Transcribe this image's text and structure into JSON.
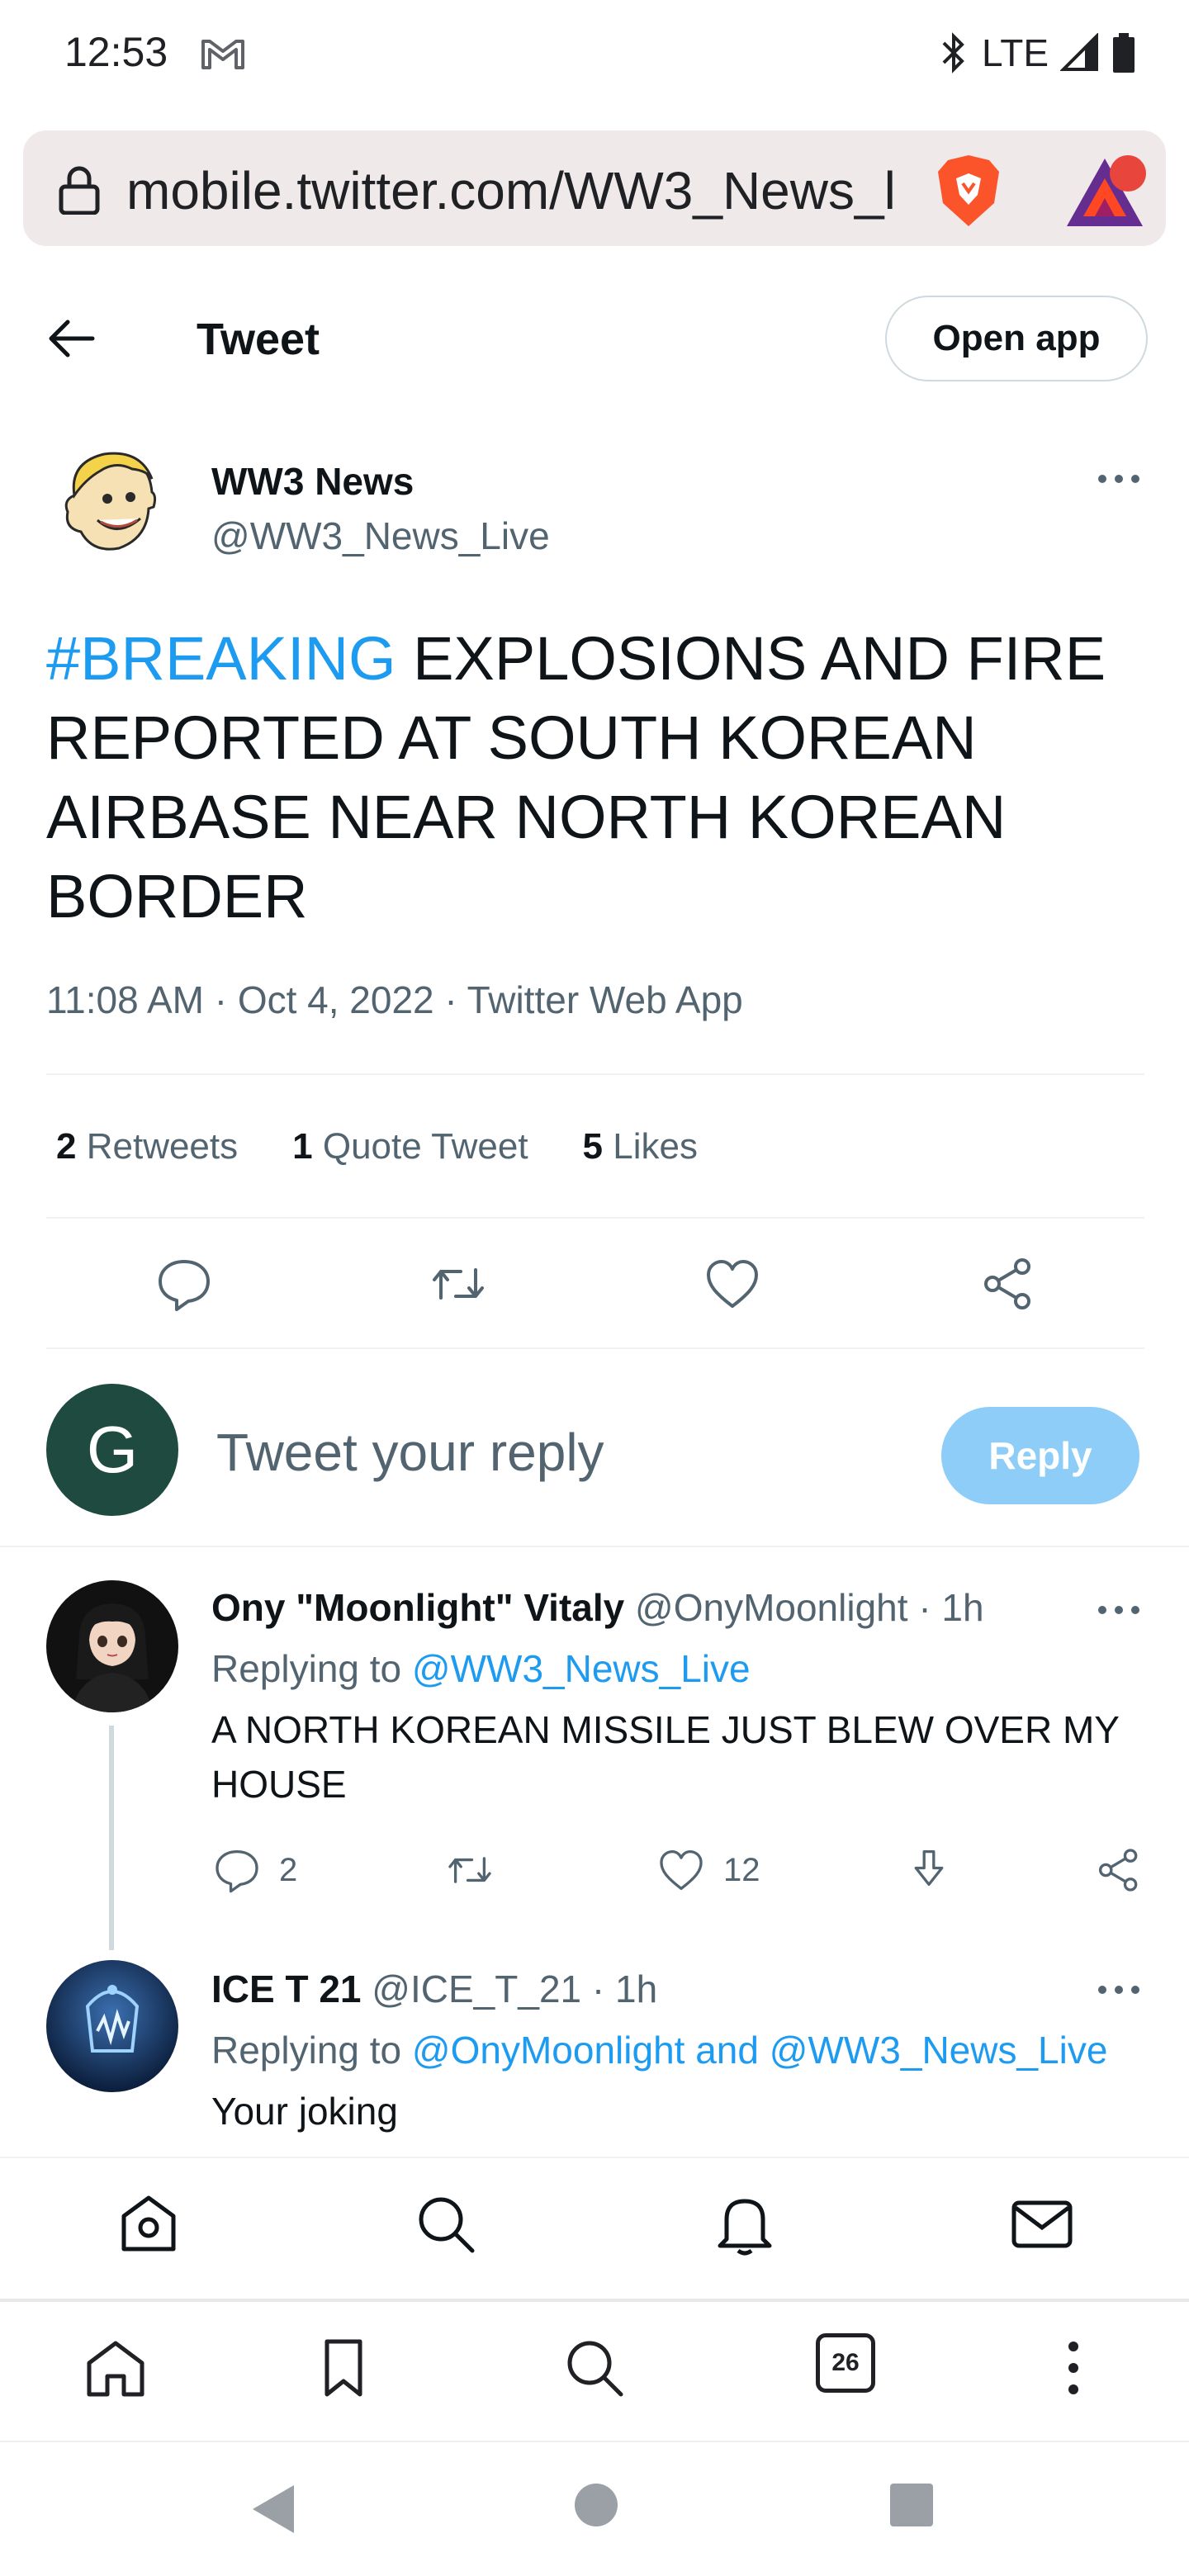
{
  "status_bar": {
    "time": "12:53",
    "network": "LTE"
  },
  "browser": {
    "url": "mobile.twitter.com/WW3_News_l",
    "tab_count": "26"
  },
  "header": {
    "title": "Tweet",
    "open_app_label": "Open app"
  },
  "tweet": {
    "author_name": "WW3 News",
    "author_handle": "@WW3_News_Live",
    "hashtag": "#BREAKING",
    "text": " EXPLOSIONS AND FIRE REPORTED AT SOUTH KOREAN AIRBASE NEAR NORTH KOREAN BORDER",
    "meta": "11:08 AM · Oct 4, 2022 · Twitter Web App",
    "stats": {
      "retweets_count": "2",
      "retweets_label": "Retweets",
      "quotes_count": "1",
      "quotes_label": "Quote Tweet",
      "likes_count": "5",
      "likes_label": "Likes"
    }
  },
  "composer": {
    "avatar_letter": "G",
    "placeholder": "Tweet your reply",
    "reply_label": "Reply"
  },
  "replies": [
    {
      "name": "Ony \"Moonlight\" Vitaly",
      "handle": "@OnyMoonlight",
      "time": "· 1h",
      "replying_prefix": "Replying to ",
      "replying_to": "@WW3_News_Live",
      "text": "A NORTH KOREAN MISSILE JUST BLEW OVER MY HOUSE",
      "reply_count": "2",
      "like_count": "12"
    },
    {
      "name": "ICE T 21",
      "handle": "@ICE_T_21",
      "time": "· 1h",
      "replying_prefix": "Replying to ",
      "replying_to": "@OnyMoonlight and @WW3_News_Live",
      "text": "Your joking"
    }
  ],
  "colors": {
    "accent": "#1d9bf0",
    "reply_button": "#8ecdf7",
    "avatar_g": "#1f4a3f"
  }
}
